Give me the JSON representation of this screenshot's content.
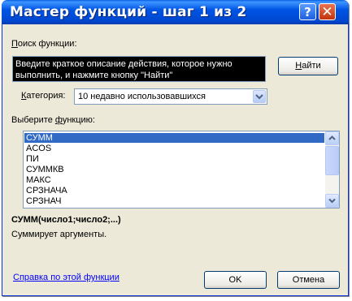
{
  "window": {
    "title": "Мастер функций - шаг 1 из 2",
    "help_icon": "?",
    "close_icon": "✕"
  },
  "search": {
    "label_hot": "П",
    "label_rest": "оиск функции:",
    "text": "Введите краткое описание действия, которое нужно выполнить, и нажмите кнопку \"Найти\"",
    "find_button_hot": "Н",
    "find_button_rest": "айти"
  },
  "category": {
    "label_hot": "К",
    "label_rest": "атегория:",
    "value": "10 недавно использовавшихся"
  },
  "functions": {
    "label_start": "Выберите ",
    "label_hot": "ф",
    "label_rest": "ункцию:",
    "items": [
      "СУММ",
      "ACOS",
      "ПИ",
      "СУММКВ",
      "МАКС",
      "СРЗНАЧА",
      "СРЗНАЧ"
    ],
    "selected_index": 0
  },
  "selected_function": {
    "signature": "СУММ(число1;число2;...)",
    "description": "Суммирует аргументы."
  },
  "footer": {
    "help_link": "Справка по этой функции",
    "ok_label": "OK",
    "cancel_label": "Отмена"
  },
  "colors": {
    "titlebar": "#0055e5",
    "selection": "#316ac5",
    "link": "#0000ff",
    "dialog_bg": "#ece9d8"
  }
}
